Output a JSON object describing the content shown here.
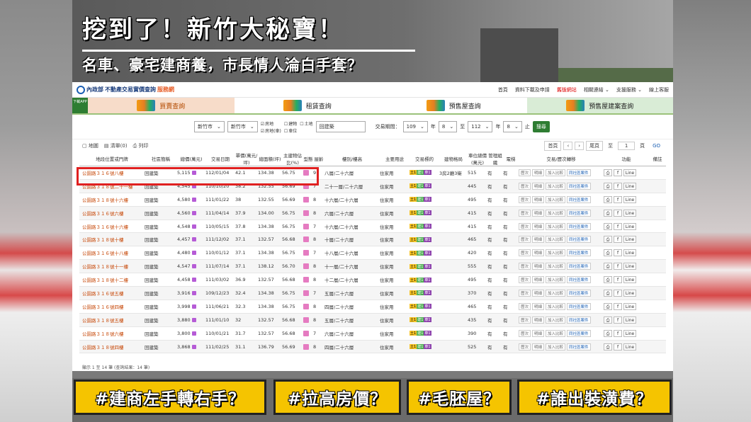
{
  "headline": "挖到了！新竹大秘寶！",
  "subhead": "名車、豪宅建商養，市長情人淪白手套？",
  "site": {
    "logo_name": "內政部",
    "logo_title": "不動產交易實價查詢",
    "logo_service": "服務網",
    "top_links": [
      "首頁",
      "資料下載及申請",
      "舊版網站",
      "相關連結 ⌄",
      "支援服務 ⌄",
      "線上客服"
    ],
    "qr_label": "下載APP",
    "tabs": [
      "買賣查詢",
      "租賃查詢",
      "預售屋查詢",
      "預售屋建案查詢"
    ],
    "filter": {
      "city": "新竹市",
      "district": "新竹市",
      "checks": [
        {
          "label": "房地",
          "on": true
        },
        {
          "label": "建物",
          "on": false
        },
        {
          "label": "土地",
          "on": false
        },
        {
          "label": "房地(車)",
          "on": true
        },
        {
          "label": "車位",
          "on": false
        }
      ],
      "keyword": "回建築",
      "period_label": "交易期間：",
      "from_year": "109",
      "from_month": "8",
      "year_unit": "年",
      "month_unit": "月",
      "to_label": "至",
      "to_year": "112",
      "to_month": "8",
      "stop_label": "止",
      "search_btn": "搜尋"
    },
    "toolbar": {
      "map": "地圖",
      "list": "清單(0)",
      "print": "列印",
      "first": "首頁",
      "prev": "‹",
      "next": "›",
      "last": "尾頁",
      "to_label": "至",
      "page": "1",
      "page_unit": "頁",
      "go": "GO"
    },
    "columns": [
      "地段位置或門牌",
      "社區簡稱",
      "總價(萬元)",
      "交易日期",
      "單價(萬元/坪)",
      "總面積(坪)",
      "主建物佔比(%)",
      "型態",
      "屋齡",
      "樓別/樓高",
      "主要用途",
      "交易標的",
      "建物格局",
      "車位總價(萬元)",
      "管理組織",
      "電梯",
      "交易/歷次轉移",
      "功能",
      "備註"
    ],
    "rows": [
      [
        "公園路３１６號八樓",
        "回建築",
        "5,115",
        "112/01/04",
        "42.1",
        "134.38",
        "56.75",
        "9",
        "八層/二十六層",
        "住家用",
        "3房2廳3衛",
        "515",
        "有",
        "有"
      ],
      [
        "公園路３１８號二十一樓",
        "回建築",
        "4,545",
        "110/10/20",
        "38.2",
        "132.55",
        "56.69",
        "7",
        "二十一層/二十六層",
        "住家用",
        "",
        "445",
        "有",
        "有"
      ],
      [
        "公園路３１８號十六樓",
        "回建築",
        "4,580",
        "111/01/22",
        "38",
        "132.55",
        "56.69",
        "8",
        "十六層/二十六層",
        "住家用",
        "",
        "495",
        "有",
        "有"
      ],
      [
        "公園路３１６號六樓",
        "回建築",
        "4,560",
        "111/04/14",
        "37.9",
        "134.00",
        "56.75",
        "8",
        "六層/二十六層",
        "住家用",
        "",
        "415",
        "有",
        "有"
      ],
      [
        "公園路３１６號十六樓",
        "回建築",
        "4,548",
        "110/05/15",
        "37.8",
        "134.38",
        "56.75",
        "7",
        "十六層/二十六層",
        "住家用",
        "",
        "415",
        "有",
        "有"
      ],
      [
        "公園路３１８號十樓",
        "回建築",
        "4,457",
        "111/12/02",
        "37.1",
        "132.57",
        "56.68",
        "8",
        "十層/二十六層",
        "住家用",
        "",
        "465",
        "有",
        "有"
      ],
      [
        "公園路３１６號十八樓",
        "回建築",
        "4,480",
        "110/01/12",
        "37.1",
        "134.38",
        "56.75",
        "7",
        "十八層/二十六層",
        "住家用",
        "",
        "420",
        "有",
        "有"
      ],
      [
        "公園路３１８號十一樓",
        "回建築",
        "4,547",
        "111/07/14",
        "37.1",
        "138.12",
        "56.70",
        "8",
        "十一層/二十六層",
        "住家用",
        "",
        "555",
        "有",
        "有"
      ],
      [
        "公園路３１８號十二樓",
        "回建築",
        "4,458",
        "111/03/02",
        "36.9",
        "132.57",
        "56.68",
        "8",
        "十二層/二十六層",
        "住家用",
        "",
        "495",
        "有",
        "有"
      ],
      [
        "公園路３１６號五樓",
        "回建築",
        "3,916",
        "109/12/23",
        "32.4",
        "134.38",
        "56.75",
        "7",
        "五層/二十六層",
        "住家用",
        "",
        "370",
        "有",
        "有"
      ],
      [
        "公園路３１６號四樓",
        "回建築",
        "3,998",
        "111/06/21",
        "32.3",
        "134.38",
        "56.75",
        "8",
        "四層/二十六層",
        "住家用",
        "",
        "465",
        "有",
        "有"
      ],
      [
        "公園路３１８號五樓",
        "回建築",
        "3,880",
        "111/01/10",
        "32",
        "132.57",
        "56.68",
        "8",
        "五層/二十六層",
        "住家用",
        "",
        "435",
        "有",
        "有"
      ],
      [
        "公園路３１８號六樓",
        "回建築",
        "3,800",
        "110/01/21",
        "31.7",
        "132.57",
        "56.68",
        "7",
        "六層/二十六層",
        "住家用",
        "",
        "390",
        "有",
        "有"
      ],
      [
        "公園路３１８號四樓",
        "回建築",
        "3,868",
        "111/02/25",
        "31.1",
        "136.79",
        "56.69",
        "8",
        "四層/二十六層",
        "住家用",
        "",
        "525",
        "有",
        "有"
      ]
    ],
    "row_actions": [
      "歷次",
      "明細",
      "加入比較",
      "同社區案件"
    ],
    "row_funcs": [
      "⎙",
      "f",
      "Line"
    ],
    "footnote": "顯示 1 至 14 筆 (查詢結果：14 筆)"
  },
  "tags": [
    "#建商左手轉右手？",
    "#拉高房價？",
    "#毛胚屋？",
    "#誰出裝潢費？"
  ],
  "colors": {
    "tag_bg": "#f5c400",
    "highlight": "#e02020",
    "addr": "#c84b0c"
  }
}
